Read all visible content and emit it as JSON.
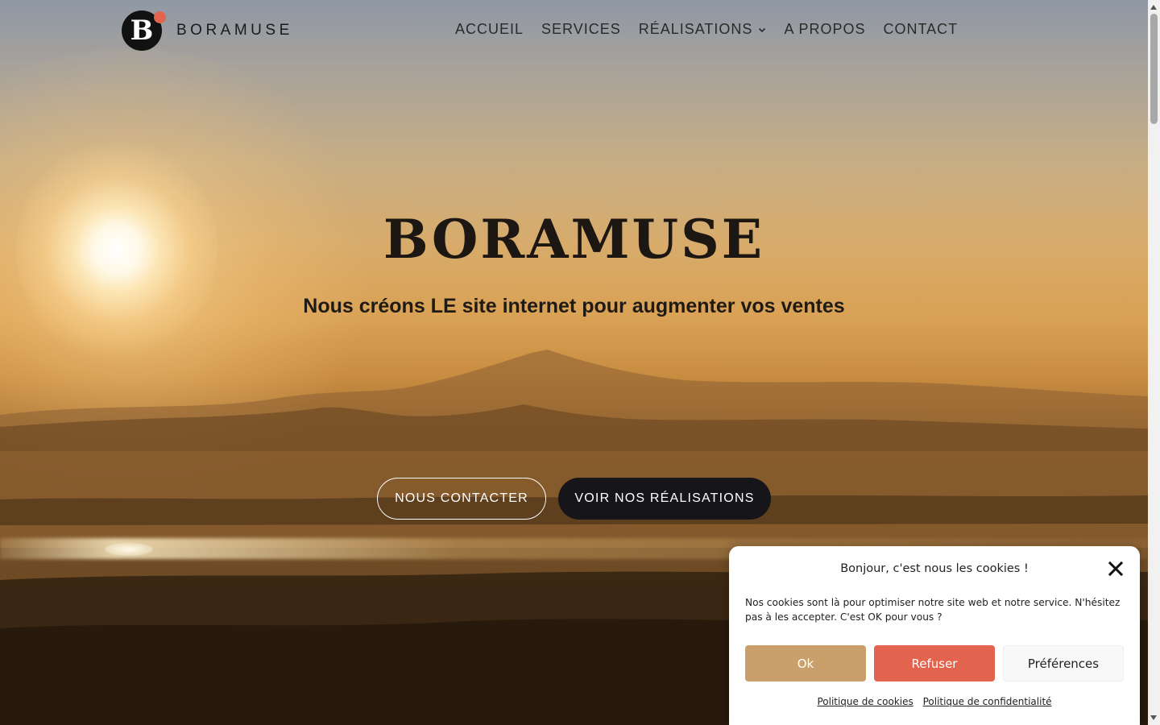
{
  "header": {
    "logo_letter": "B",
    "logo_text": "BORAMUSE",
    "nav": [
      {
        "label": "ACCUEIL"
      },
      {
        "label": "SERVICES"
      },
      {
        "label": "RÉALISATIONS"
      },
      {
        "label": "A PROPOS"
      },
      {
        "label": "CONTACT"
      }
    ]
  },
  "hero": {
    "title": "BORAMUSE",
    "subtitle": "Nous créons LE site internet pour augmenter vos ventes",
    "buttons": {
      "contact": "NOUS CONTACTER",
      "work": "VOIR NOS RÉALISATIONS"
    }
  },
  "cookie": {
    "title": "Bonjour, c'est nous les cookies !",
    "text": "Nos cookies sont là pour optimiser notre site web et notre service. N'hésitez pas à les accepter. C'est OK pour vous ?",
    "buttons": {
      "ok": "Ok",
      "refuse": "Refuser",
      "prefs": "Préférences"
    },
    "links": {
      "cookie_policy": "Politique de cookies",
      "privacy_policy": "Politique de confidentialité"
    }
  },
  "colors": {
    "accent_red": "#e3644e",
    "ok_tan": "#c9a06b",
    "dark_button": "#16161a"
  },
  "icons": {
    "close": "close-icon",
    "dropdown": "chevron-down-icon"
  }
}
